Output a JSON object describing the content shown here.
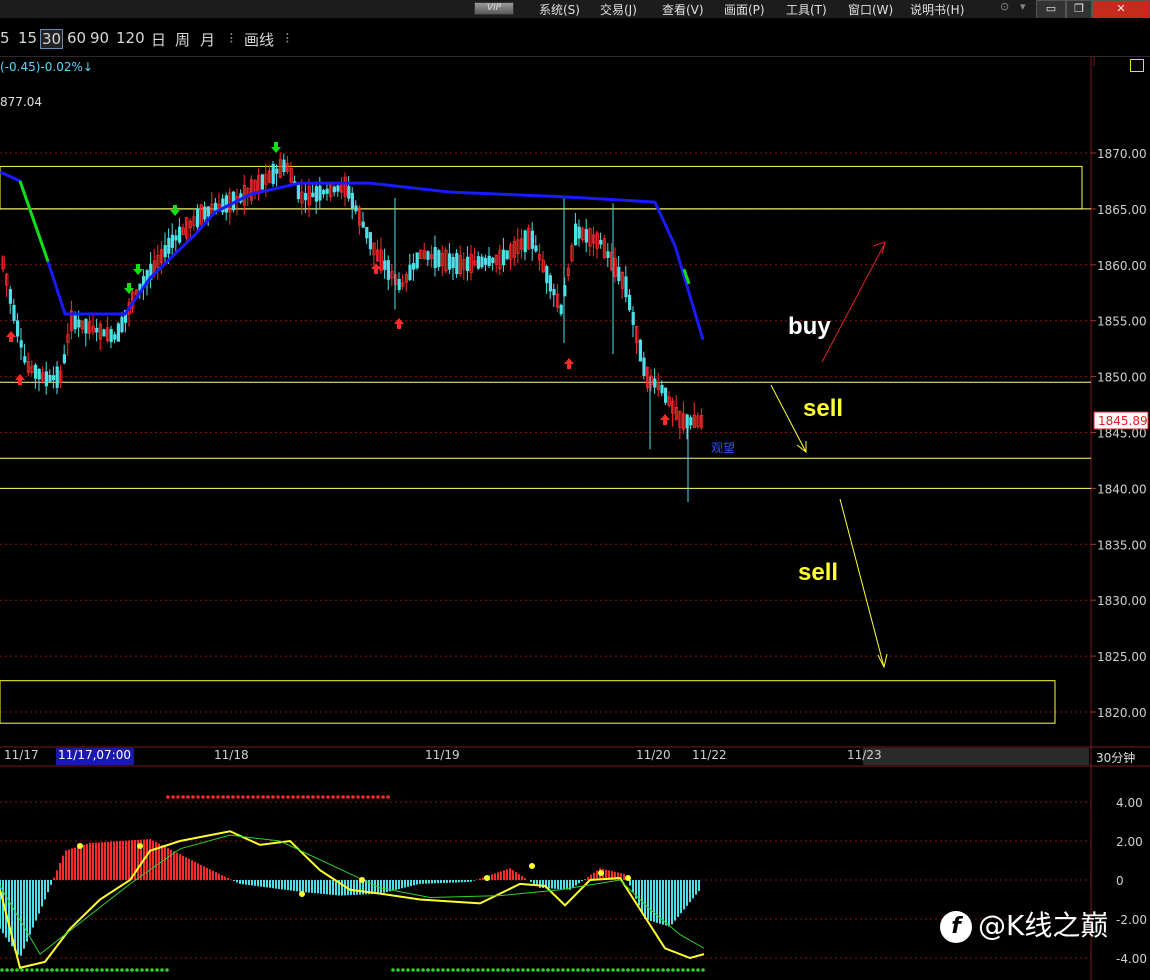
{
  "menubar": {
    "vip": "VIP",
    "items": [
      "系统(S)",
      "交易(J)",
      "查看(V)",
      "画面(P)",
      "工具(T)",
      "窗口(W)",
      "说明书(H)"
    ],
    "win_buttons": [
      "▭",
      "❐",
      "✕"
    ]
  },
  "toolbar": {
    "periods": [
      "5",
      "15",
      "30",
      "60",
      "90",
      "120",
      "日",
      "周",
      "月"
    ],
    "active_period": "30",
    "draw_label": "画线",
    "more_icon": "vertical-dots-icon"
  },
  "header": {
    "change_text": "(-0.45)-0.02%↓",
    "open_value": "877.04"
  },
  "chart_data": [
    {
      "type": "candlestick",
      "title": "",
      "current_price": 1845.89,
      "current_price_label": "1845.89",
      "ylim": [
        1815,
        1875
      ],
      "y_ticks": [
        "1870.00",
        "1865.00",
        "1860.00",
        "1855.00",
        "1850.00",
        "1845.00",
        "1840.00",
        "1835.00",
        "1830.00",
        "1825.00",
        "1820.00"
      ],
      "x_labels": [
        "11/17",
        "11/17,07:00",
        "11/18",
        "11/19",
        "11/20",
        "11/22",
        "11/23"
      ],
      "period_label": "30分钟",
      "status_tag": "观望",
      "horizontal_lines": [
        1865,
        1849.5,
        1842.7,
        1840
      ],
      "zones": [
        {
          "from": 1865,
          "to": 1868.8
        },
        {
          "from": 1819,
          "to": 1822.8
        }
      ],
      "annotations": [
        {
          "text": "buy",
          "color": "#ffffff"
        },
        {
          "text": "sell",
          "color": "#ffff30"
        },
        {
          "text": "sell",
          "color": "#ffff30"
        }
      ],
      "ma_line": [
        [
          0,
          1868.3
        ],
        [
          20,
          1867.5
        ],
        [
          48,
          1860.3
        ],
        [
          65,
          1855.6
        ],
        [
          125,
          1855.6
        ],
        [
          150,
          1858.8
        ],
        [
          195,
          1862.7
        ],
        [
          215,
          1864.7
        ],
        [
          250,
          1866.3
        ],
        [
          300,
          1867.3
        ],
        [
          370,
          1867.3
        ],
        [
          450,
          1866.5
        ],
        [
          560,
          1866.1
        ],
        [
          620,
          1865.8
        ],
        [
          655,
          1865.6
        ],
        [
          675,
          1861.7
        ],
        [
          703,
          1853.3
        ]
      ]
    },
    {
      "type": "macd",
      "y_ticks": [
        "4.00",
        "2.00",
        "0",
        "-2.00",
        "-4.00"
      ]
    }
  ],
  "watermark": {
    "logo": "f",
    "text": "@K线之巅"
  },
  "colors": {
    "up": "#ff2a2a",
    "down": "#4ee0e8",
    "ma": "#1a1aff",
    "ma_green": "#10e010",
    "yellow": "#ffff30",
    "grid": "#8a1010"
  }
}
